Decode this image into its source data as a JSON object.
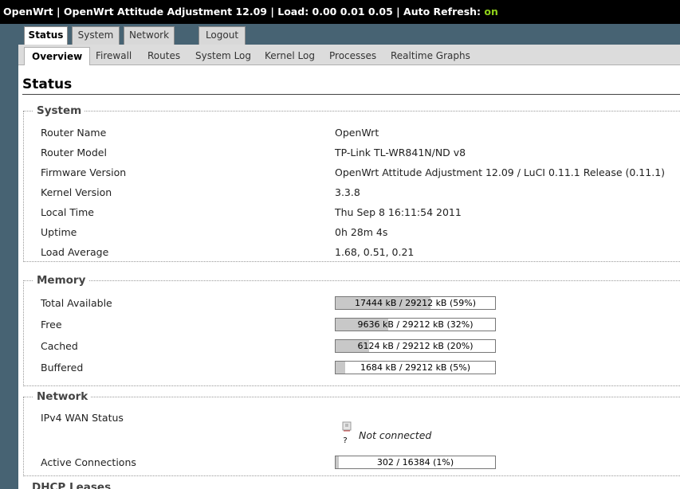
{
  "header": {
    "title_text": "OpenWrt | OpenWrt Attitude Adjustment 12.09 | Load: 0.00 0.01 0.05 | Auto Refresh: ",
    "auto_refresh_state": "on",
    "auto_refresh_color": "#8fd21a"
  },
  "main_tabs": [
    {
      "label": "Status",
      "active": true
    },
    {
      "label": "System",
      "active": false
    },
    {
      "label": "Network",
      "active": false
    },
    {
      "label": "Logout",
      "active": false
    }
  ],
  "sub_tabs": [
    {
      "label": "Overview",
      "active": true
    },
    {
      "label": "Firewall",
      "active": false
    },
    {
      "label": "Routes",
      "active": false
    },
    {
      "label": "System Log",
      "active": false
    },
    {
      "label": "Kernel Log",
      "active": false
    },
    {
      "label": "Processes",
      "active": false
    },
    {
      "label": "Realtime Graphs",
      "active": false
    }
  ],
  "page": {
    "title": "Status"
  },
  "system": {
    "legend": "System",
    "rows": [
      {
        "label": "Router Name",
        "value": "OpenWrt"
      },
      {
        "label": "Router Model",
        "value": "TP-Link TL-WR841N/ND v8"
      },
      {
        "label": "Firmware Version",
        "value": "OpenWrt Attitude Adjustment 12.09 / LuCI 0.11.1 Release (0.11.1)"
      },
      {
        "label": "Kernel Version",
        "value": "3.3.8"
      },
      {
        "label": "Local Time",
        "value": "Thu Sep 8 16:11:54 2011"
      },
      {
        "label": "Uptime",
        "value": "0h 28m 4s"
      },
      {
        "label": "Load Average",
        "value": "1.68, 0.51, 0.21"
      }
    ]
  },
  "memory": {
    "legend": "Memory",
    "rows": [
      {
        "label": "Total Available",
        "text": "17444 kB / 29212 kB (59%)",
        "fraction": 0.597
      },
      {
        "label": "Free",
        "text": "9636 kB / 29212 kB (32%)",
        "fraction": 0.33
      },
      {
        "label": "Cached",
        "text": "6124 kB / 29212 kB (20%)",
        "fraction": 0.21
      },
      {
        "label": "Buffered",
        "text": "1684 kB / 29212 kB (5%)",
        "fraction": 0.058
      }
    ]
  },
  "network": {
    "legend": "Network",
    "wan_label": "IPv4 WAN Status",
    "wan_icon_text": "?",
    "wan_status": "Not connected",
    "connections_label": "Active Connections",
    "connections_text": "302 / 16384 (1%)",
    "connections_fraction": 0.018
  },
  "next_section_legend": "DHCP Leases"
}
